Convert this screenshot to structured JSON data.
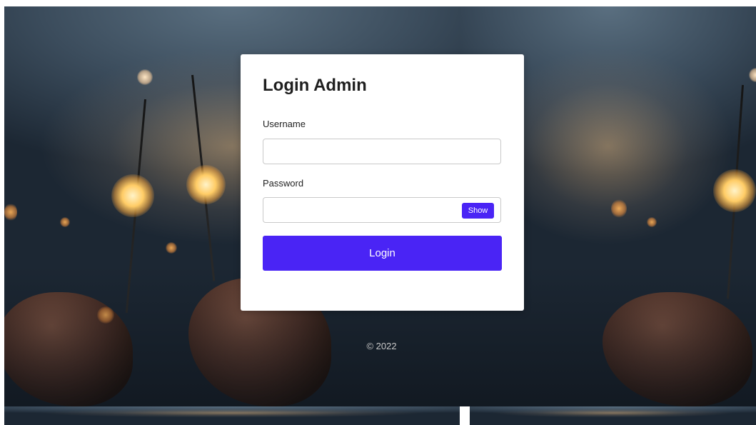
{
  "login": {
    "title": "Login Admin",
    "username_label": "Username",
    "username_value": "",
    "password_label": "Password",
    "password_value": "",
    "show_label": "Show",
    "login_label": "Login"
  },
  "footer": {
    "copyright": "© 2022"
  },
  "colors": {
    "accent": "#4a24f5",
    "card": "#ffffff",
    "footer_text": "#c8c8c8"
  }
}
